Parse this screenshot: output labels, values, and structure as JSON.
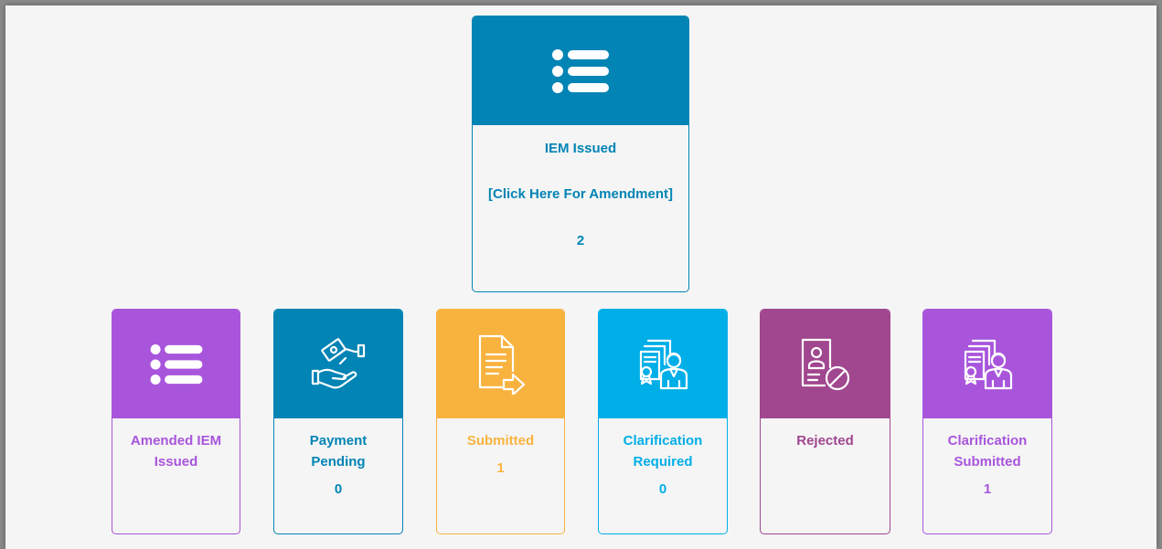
{
  "top_card": {
    "title": "IEM Issued",
    "link": "[Click Here For Amendment]",
    "count": "2",
    "color": "#0284b5",
    "icon": "list-icon"
  },
  "cards": [
    {
      "title_line1": "Amended IEM",
      "title_line2": "Issued",
      "count": "",
      "color": "#a855dc",
      "icon": "list-icon"
    },
    {
      "title_line1": "Payment",
      "title_line2": "Pending",
      "count": "0",
      "color": "#0284b5",
      "icon": "handshake-money-icon"
    },
    {
      "title_line1": "Submitted",
      "title_line2": "",
      "count": "1",
      "color": "#f8b33f",
      "icon": "document-submit-icon"
    },
    {
      "title_line1": "Clarification",
      "title_line2": "Required",
      "count": "0",
      "color": "#00aee8",
      "icon": "certificate-person-icon"
    },
    {
      "title_line1": "Rejected",
      "title_line2": "",
      "count": "",
      "color": "#a0478f",
      "icon": "rejected-document-icon"
    },
    {
      "title_line1": "Clarification",
      "title_line2": "Submitted",
      "count": "1",
      "color": "#a855dc",
      "icon": "certificate-person-icon"
    }
  ]
}
